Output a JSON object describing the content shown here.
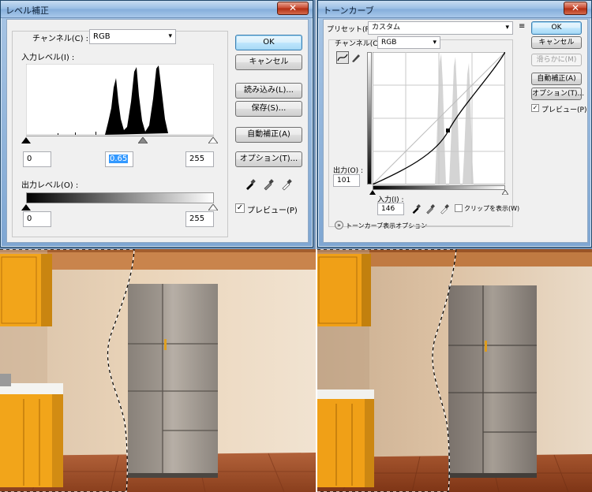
{
  "levels": {
    "title": "レベル補正",
    "channel_label": "チャンネル(C) :",
    "channel_value": "RGB",
    "input_label": "入力レベル(I) :",
    "input_black": "0",
    "input_gamma": "0.65",
    "input_white": "255",
    "output_label": "出力レベル(O) :",
    "output_black": "0",
    "output_white": "255",
    "buttons": {
      "ok": "OK",
      "cancel": "キャンセル",
      "load": "読み込み(L)...",
      "save": "保存(S)...",
      "auto": "自動補正(A)",
      "options": "オプション(T)..."
    },
    "preview_label": "プレビュー(P)",
    "preview_checked": true
  },
  "curves": {
    "title": "トーンカーブ",
    "preset_label": "プリセット(R) :",
    "preset_value": "カスタム",
    "channel_label": "チャンネル(C) :",
    "channel_value": "RGB",
    "output_label": "出力(O) :",
    "output_value": "101",
    "input_label": "入力(I) :",
    "input_value": "146",
    "clip_label": "クリップを表示(W)",
    "display_options_label": "トーンカーブ表示オプション",
    "buttons": {
      "ok": "OK",
      "cancel": "キャンセル",
      "smooth": "滑らかに(M)",
      "auto": "自動補正(A)",
      "options": "オプション(T)..."
    },
    "preview_label": "プレビュー(P)",
    "preview_checked": true
  },
  "colors": {
    "title_bar": "#98bde4",
    "dialog_bg": "#f0f0f0",
    "highlight": "#3399ff",
    "cabinet": "#f2a51a",
    "floor": "#a3552d",
    "wall": "#e9d1b6"
  },
  "glyphs": {
    "check": "✓",
    "arrow": "▾",
    "close": "✕",
    "expand": "»",
    "menu": "≡"
  }
}
